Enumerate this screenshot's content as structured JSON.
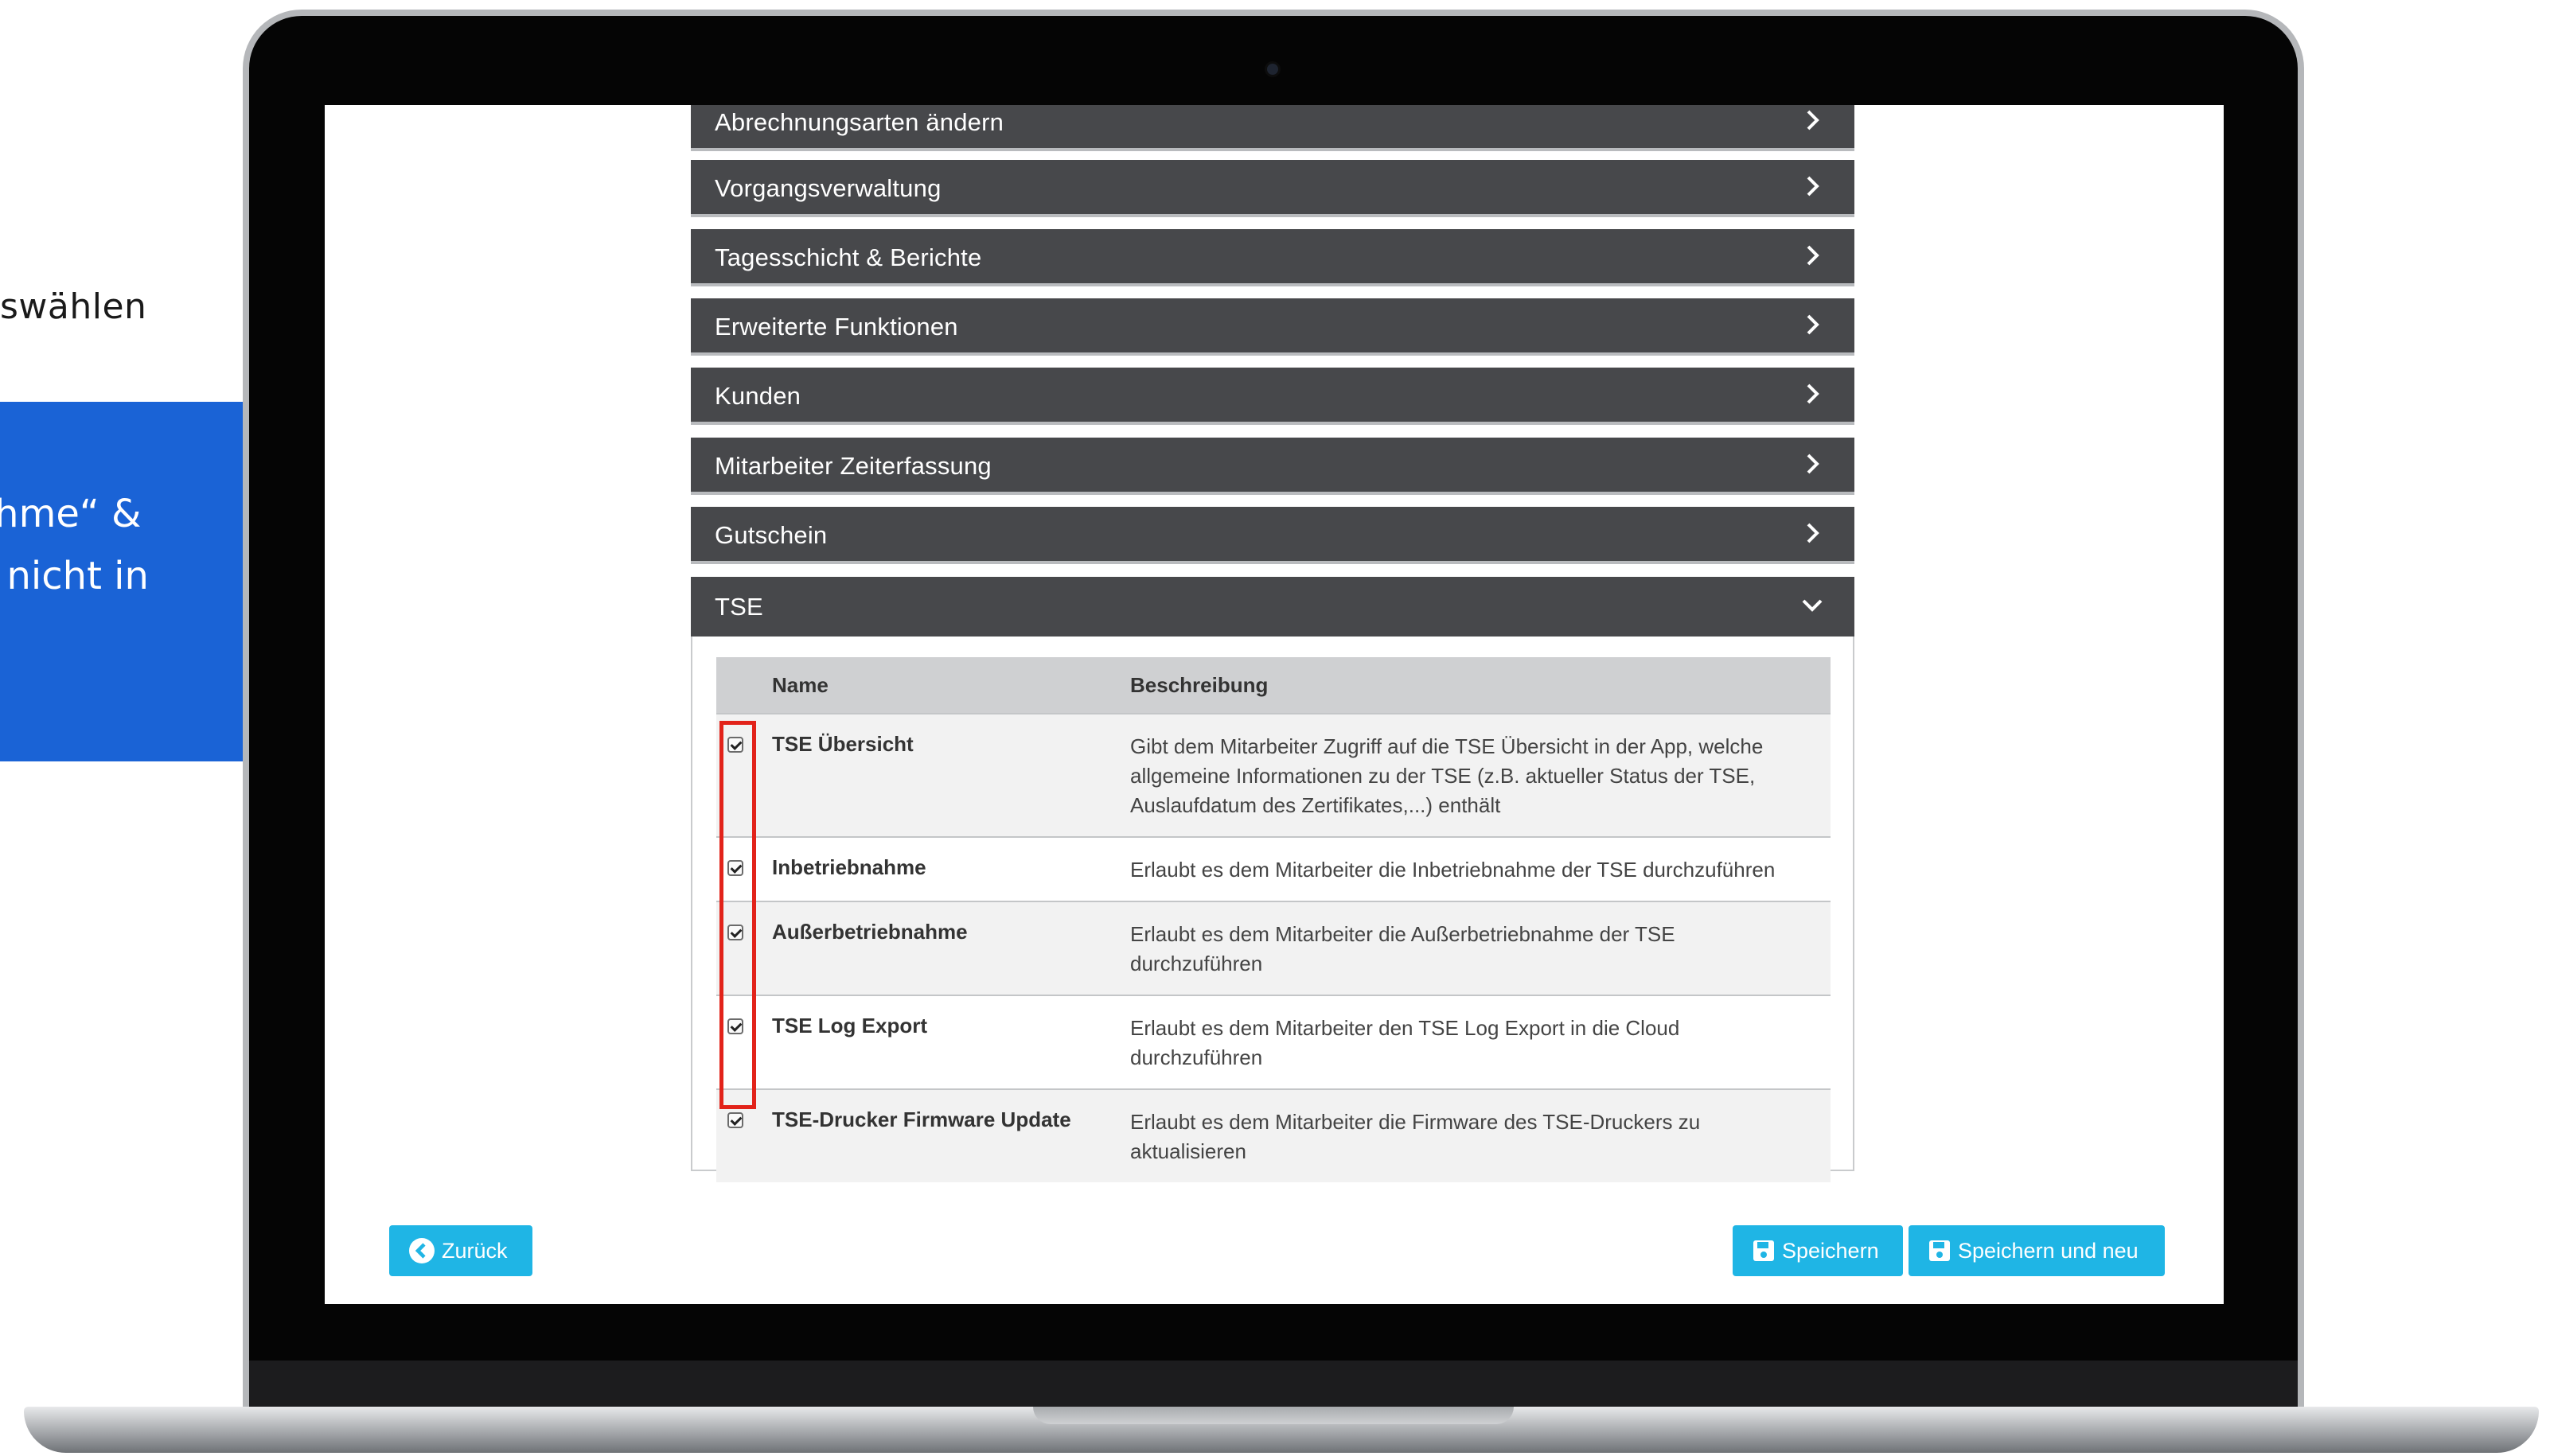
{
  "side": {
    "top_text": "swählen",
    "callout_line1": "iebnahme“ &",
    "callout_line2": "ktuell nicht in"
  },
  "panels": [
    {
      "title": "Abrechnungsarten ändern",
      "state": "collapsed"
    },
    {
      "title": "Vorgangsverwaltung",
      "state": "collapsed"
    },
    {
      "title": "Tagesschicht & Berichte",
      "state": "collapsed"
    },
    {
      "title": "Erweiterte Funktionen",
      "state": "collapsed"
    },
    {
      "title": "Kunden",
      "state": "collapsed"
    },
    {
      "title": "Mitarbeiter Zeiterfassung",
      "state": "collapsed"
    },
    {
      "title": "Gutschein",
      "state": "collapsed"
    },
    {
      "title": "TSE",
      "state": "expanded"
    }
  ],
  "tse_table": {
    "headers": {
      "name": "Name",
      "description": "Beschreibung"
    },
    "rows": [
      {
        "checked": true,
        "name": "TSE Übersicht",
        "description": "Gibt dem Mitarbeiter Zugriff auf die TSE Übersicht in der App, welche allgemeine Informationen zu der TSE (z.B. aktueller Status der TSE, Auslaufdatum des Zertifikates,...) enthält"
      },
      {
        "checked": true,
        "name": "Inbetriebnahme",
        "description": "Erlaubt es dem Mitarbeiter die Inbetriebnahme der TSE durchzuführen"
      },
      {
        "checked": true,
        "name": "Außerbetriebnahme",
        "description": "Erlaubt es dem Mitarbeiter die Außerbetriebnahme der TSE durchzuführen"
      },
      {
        "checked": true,
        "name": "TSE Log Export",
        "description": "Erlaubt es dem Mitarbeiter den TSE Log Export in die Cloud durchzuführen"
      },
      {
        "checked": true,
        "name": "TSE-Drucker Firmware Update",
        "description": "Erlaubt es dem Mitarbeiter die Firmware des TSE-Druckers zu aktualisieren"
      }
    ]
  },
  "buttons": {
    "back": "Zurück",
    "save": "Speichern",
    "save_new": "Speichern und neu"
  },
  "colors": {
    "panel_bg": "#47484b",
    "button_accent": "#1fb5e5",
    "callout_blue": "#1a63d6",
    "highlight_red": "#e2231a"
  },
  "icons": {
    "collapsed": "chevron-right-icon",
    "expanded": "chevron-down-icon",
    "back": "circle-arrow-left-icon",
    "save": "floppy-disk-icon"
  }
}
